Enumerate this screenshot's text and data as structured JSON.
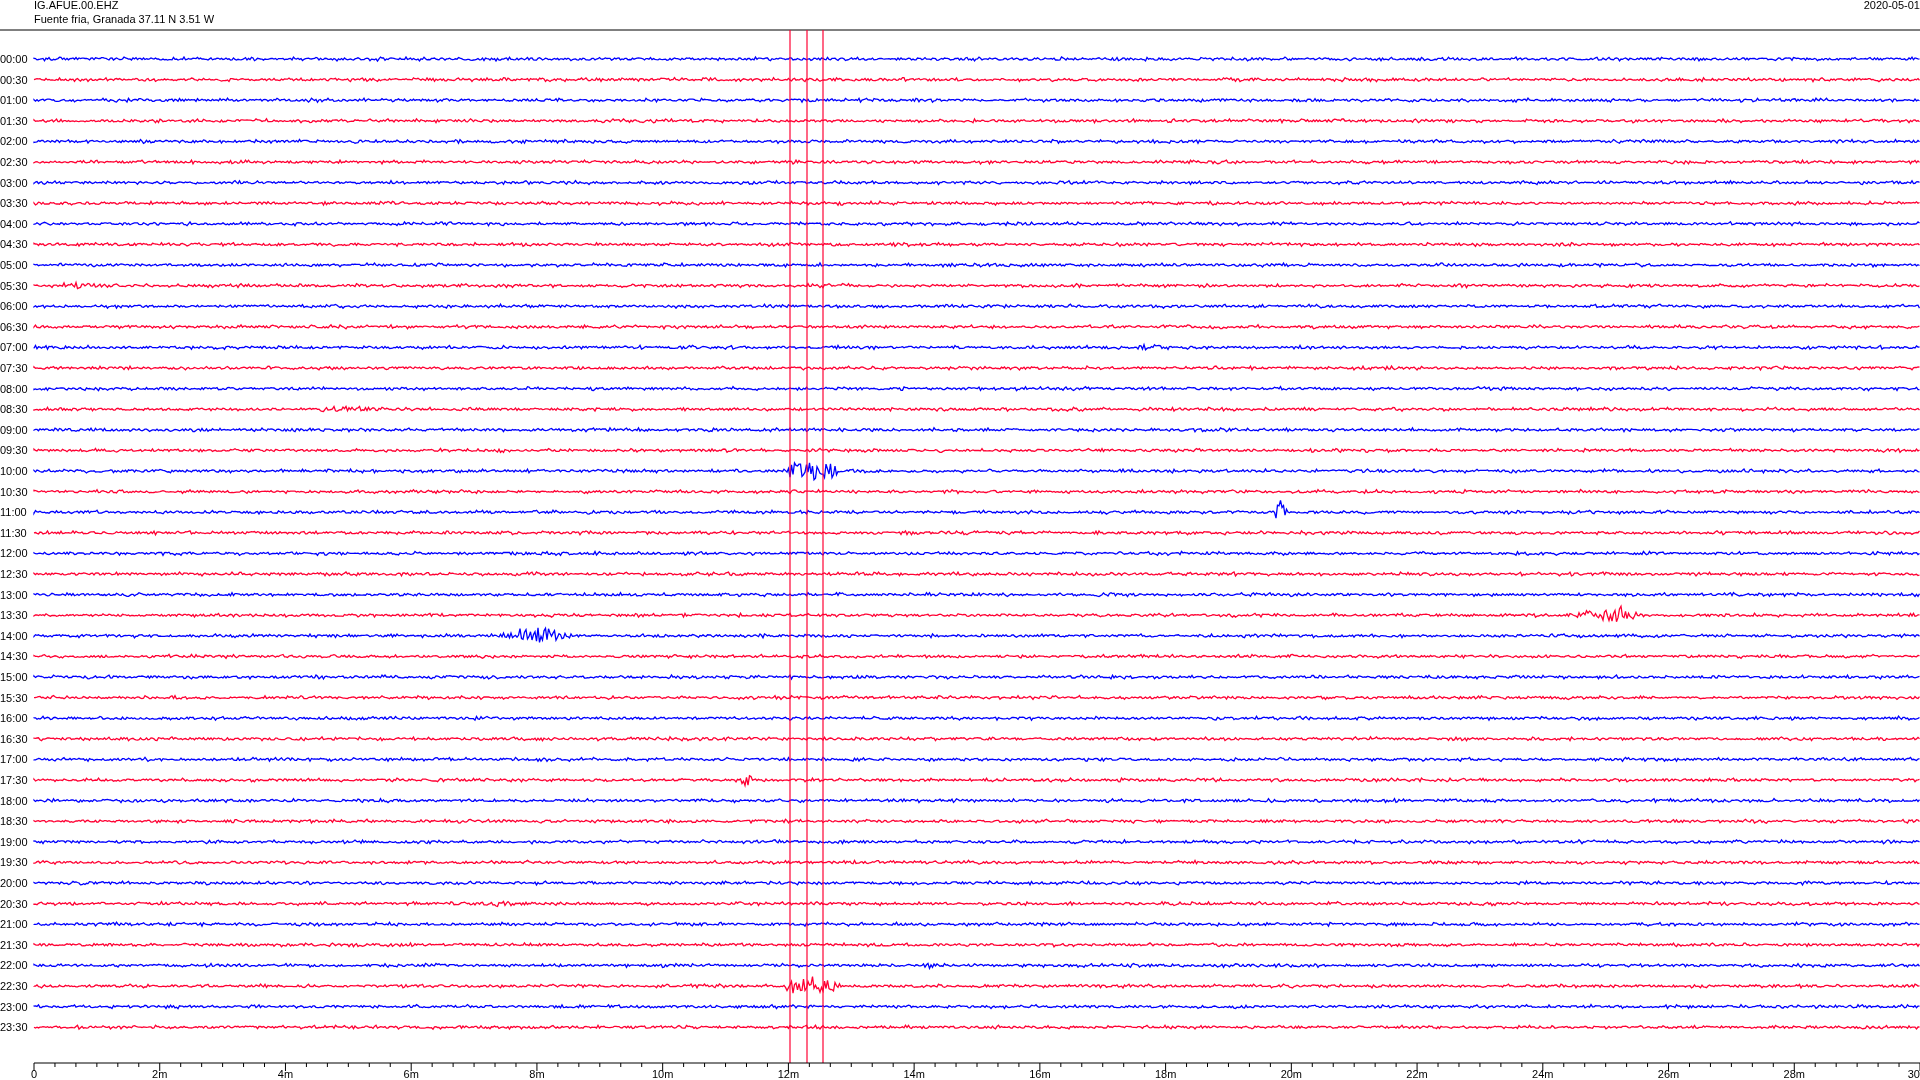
{
  "header": {
    "station": "IG.AFUE.00.EHZ",
    "location": "Fuente fria, Granada  37.11 N 3.51 W",
    "date": "2020-05-01"
  },
  "rows": [
    {
      "label": "00:00",
      "color": "#0000ff"
    },
    {
      "label": "00:30",
      "color": "#ff0033"
    },
    {
      "label": "01:00",
      "color": "#0000ff"
    },
    {
      "label": "01:30",
      "color": "#ff0033"
    },
    {
      "label": "02:00",
      "color": "#0000ff"
    },
    {
      "label": "02:30",
      "color": "#ff0033"
    },
    {
      "label": "03:00",
      "color": "#0000ff"
    },
    {
      "label": "03:30",
      "color": "#ff0033"
    },
    {
      "label": "04:00",
      "color": "#0000ff"
    },
    {
      "label": "04:30",
      "color": "#ff0033"
    },
    {
      "label": "05:00",
      "color": "#0000ff"
    },
    {
      "label": "05:30",
      "color": "#ff0033"
    },
    {
      "label": "06:00",
      "color": "#0000ff"
    },
    {
      "label": "06:30",
      "color": "#ff0033"
    },
    {
      "label": "07:00",
      "color": "#0000ff"
    },
    {
      "label": "07:30",
      "color": "#ff0033"
    },
    {
      "label": "08:00",
      "color": "#0000ff"
    },
    {
      "label": "08:30",
      "color": "#ff0033"
    },
    {
      "label": "09:00",
      "color": "#0000ff"
    },
    {
      "label": "09:30",
      "color": "#ff0033"
    },
    {
      "label": "10:00",
      "color": "#0000ff"
    },
    {
      "label": "10:30",
      "color": "#ff0033"
    },
    {
      "label": "11:00",
      "color": "#0000ff"
    },
    {
      "label": "11:30",
      "color": "#ff0033"
    },
    {
      "label": "12:00",
      "color": "#0000ff"
    },
    {
      "label": "12:30",
      "color": "#ff0033"
    },
    {
      "label": "13:00",
      "color": "#0000ff"
    },
    {
      "label": "13:30",
      "color": "#ff0033"
    },
    {
      "label": "14:00",
      "color": "#0000ff"
    },
    {
      "label": "14:30",
      "color": "#ff0033"
    },
    {
      "label": "15:00",
      "color": "#0000ff"
    },
    {
      "label": "15:30",
      "color": "#ff0033"
    },
    {
      "label": "16:00",
      "color": "#0000ff"
    },
    {
      "label": "16:30",
      "color": "#ff0033"
    },
    {
      "label": "17:00",
      "color": "#0000ff"
    },
    {
      "label": "17:30",
      "color": "#ff0033"
    },
    {
      "label": "18:00",
      "color": "#0000ff"
    },
    {
      "label": "18:30",
      "color": "#ff0033"
    },
    {
      "label": "19:00",
      "color": "#0000ff"
    },
    {
      "label": "19:30",
      "color": "#ff0033"
    },
    {
      "label": "20:00",
      "color": "#0000ff"
    },
    {
      "label": "20:30",
      "color": "#ff0033"
    },
    {
      "label": "21:00",
      "color": "#0000ff"
    },
    {
      "label": "21:30",
      "color": "#ff0033"
    },
    {
      "label": "22:00",
      "color": "#0000ff"
    },
    {
      "label": "22:30",
      "color": "#ff0033"
    },
    {
      "label": "23:00",
      "color": "#0000ff"
    },
    {
      "label": "23:30",
      "color": "#ff0033"
    }
  ],
  "x_axis": {
    "tick_labels": [
      "0",
      "2m",
      "4m",
      "6m",
      "8m",
      "10m",
      "12m",
      "14m",
      "16m",
      "18m",
      "20m",
      "22m",
      "24m",
      "26m",
      "28m",
      "30"
    ]
  }
}
